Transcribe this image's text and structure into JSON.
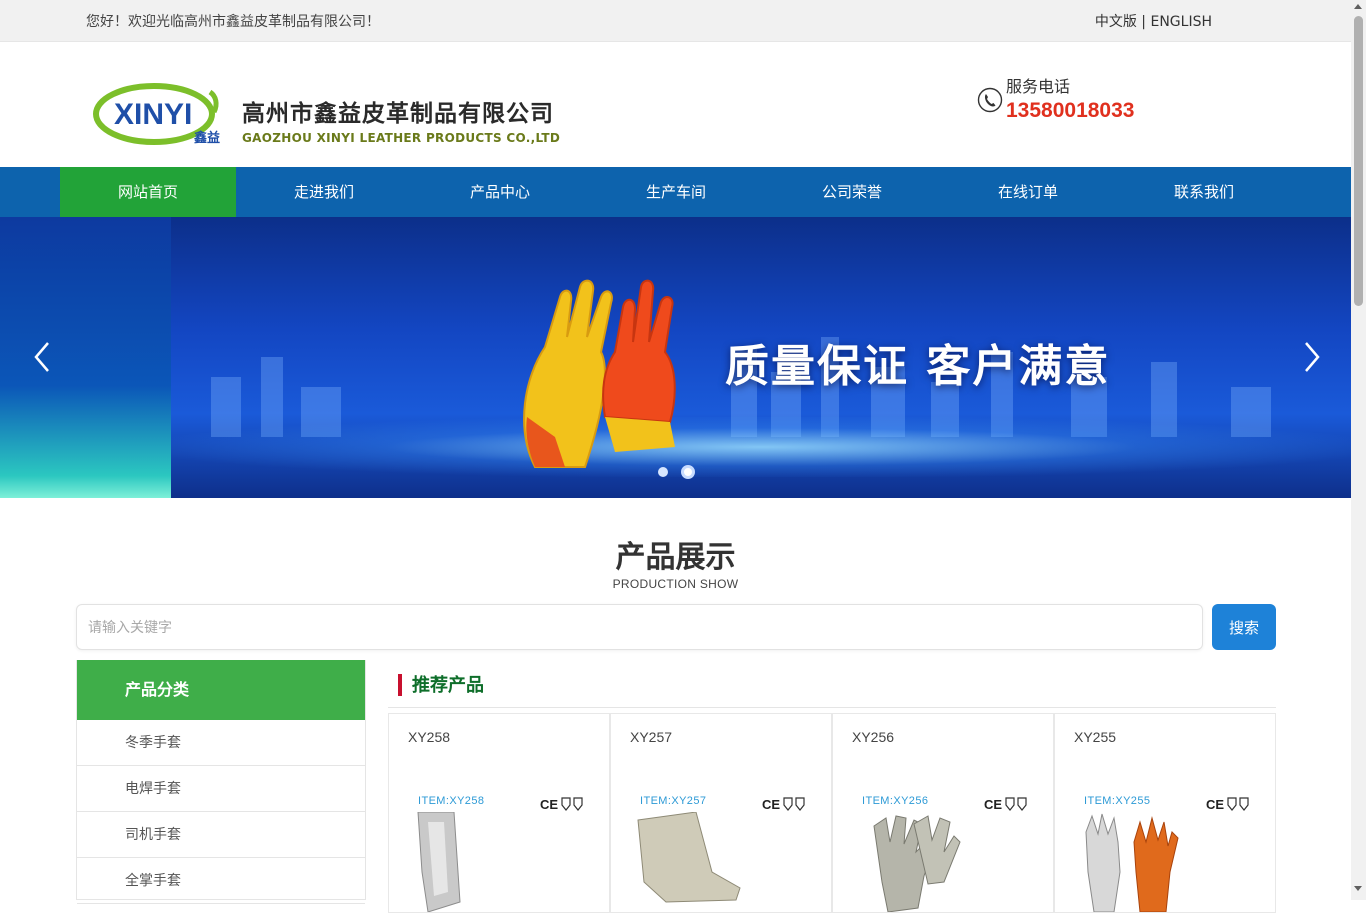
{
  "topbar": {
    "welcome": "您好！欢迎光临高州市鑫益皮革制品有限公司！",
    "lang_cn": "中文版",
    "lang_sep": " | ",
    "lang_en": "ENGLISH"
  },
  "header": {
    "logo_text": "XINYI",
    "logo_sub": "鑫益",
    "company_cn": "高州市鑫益皮革制品有限公司",
    "company_en": "GAOZHOU XINYI LEATHER PRODUCTS CO.,LTD",
    "phone_label": "服务电话",
    "phone_number": "13580018033"
  },
  "nav": {
    "items": [
      {
        "label": "网站首页",
        "active": true
      },
      {
        "label": "走进我们"
      },
      {
        "label": "产品中心"
      },
      {
        "label": "生产车间"
      },
      {
        "label": "公司荣誉"
      },
      {
        "label": "在线订单"
      },
      {
        "label": "联系我们"
      }
    ]
  },
  "banner": {
    "slogan": "质量保证  客户满意",
    "slide_count": 2,
    "active_slide": 2
  },
  "section": {
    "title": "产品展示",
    "subtitle": "PRODUCTION SHOW"
  },
  "search": {
    "placeholder": "请输入关键字",
    "button": "搜索"
  },
  "sidebar": {
    "head": "产品分类",
    "categories": [
      "冬季手套",
      "电焊手套",
      "司机手套",
      "全掌手套"
    ]
  },
  "recommended": {
    "title": "推荐产品",
    "products": [
      {
        "name": "XY258",
        "item": "ITEM:XY258"
      },
      {
        "name": "XY257",
        "item": "ITEM:XY257"
      },
      {
        "name": "XY256",
        "item": "ITEM:XY256"
      },
      {
        "name": "XY255",
        "item": "ITEM:XY255"
      }
    ]
  },
  "colors": {
    "nav": "#0d63ad",
    "nav_active": "#22a338",
    "phone": "#e0301e",
    "sidebar_head": "#3fae49",
    "search_button": "#1e82d8",
    "rec_title": "#0e6e2a",
    "rec_bar": "#c8102e"
  },
  "icons": {
    "phone": "phone-icon",
    "prev": "chevron-left-icon",
    "next": "chevron-right-icon",
    "certification": "ce-mark-icon"
  }
}
